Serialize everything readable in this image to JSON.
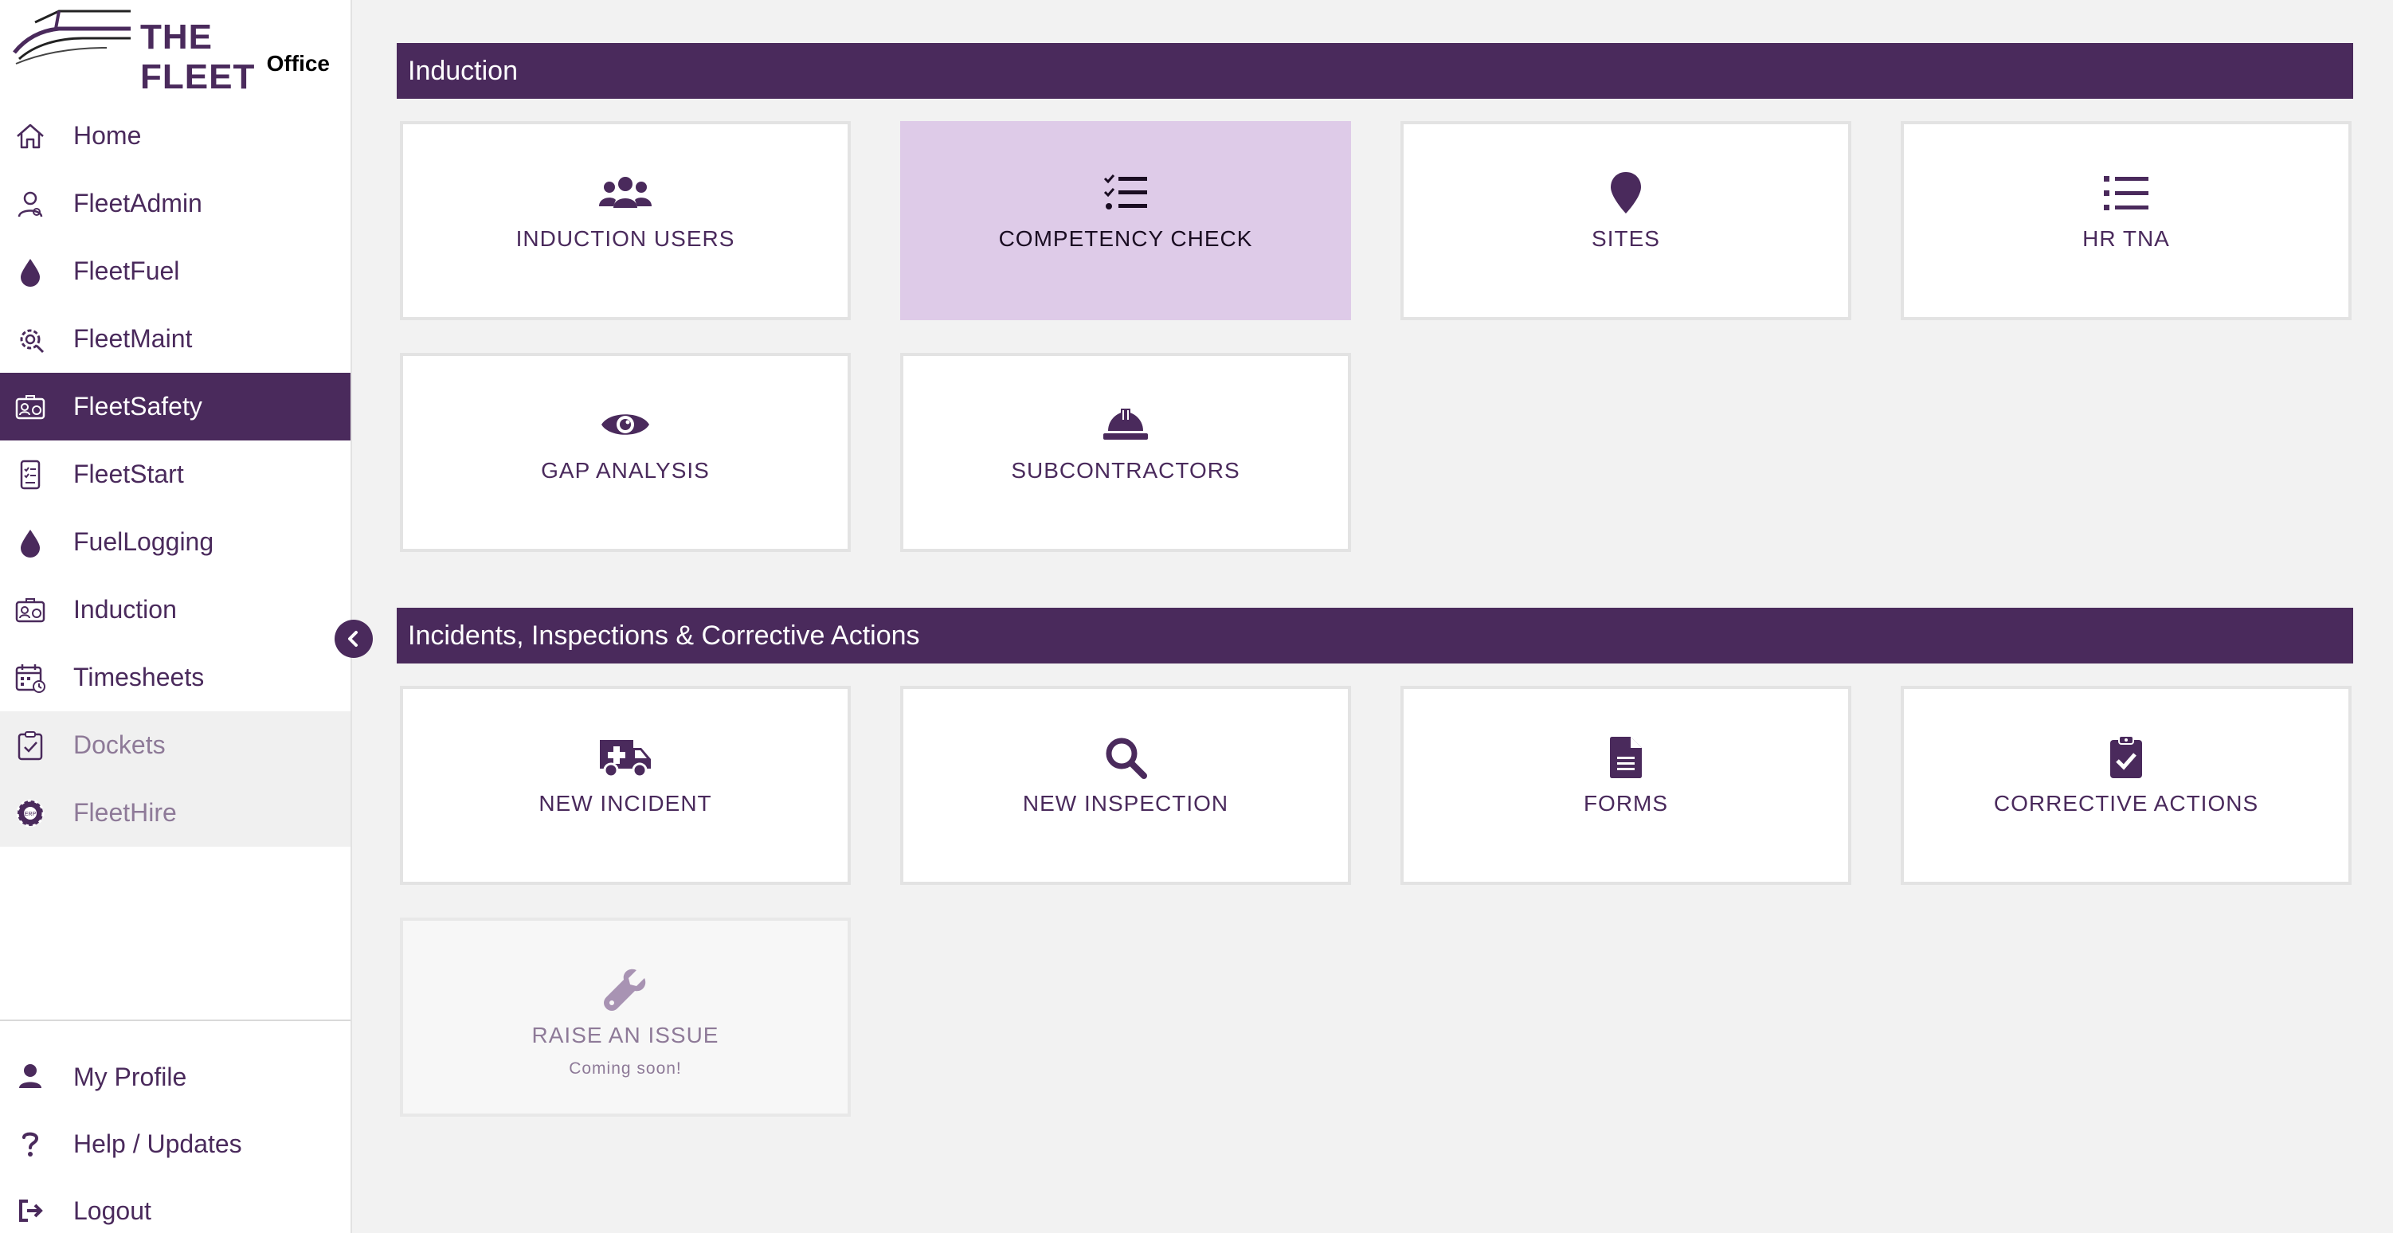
{
  "brand": {
    "name": "THE FLEET",
    "sub": "Office"
  },
  "sidebar": {
    "items": [
      {
        "label": "Home",
        "icon": "home-icon"
      },
      {
        "label": "FleetAdmin",
        "icon": "admin-user-icon"
      },
      {
        "label": "FleetFuel",
        "icon": "fuel-drop-icon"
      },
      {
        "label": "FleetMaint",
        "icon": "maintenance-gear-icon"
      },
      {
        "label": "FleetSafety",
        "icon": "id-card-icon",
        "active": true
      },
      {
        "label": "FleetStart",
        "icon": "mobile-checklist-icon"
      },
      {
        "label": "FuelLogging",
        "icon": "fuel-drop-icon"
      },
      {
        "label": "Induction",
        "icon": "id-card-icon"
      },
      {
        "label": "Timesheets",
        "icon": "calendar-clock-icon"
      },
      {
        "label": "Dockets",
        "icon": "clipboard-check-icon",
        "disabled": true
      },
      {
        "label": "FleetHire",
        "icon": "erp-gear-icon",
        "disabled": true
      }
    ],
    "bottom": [
      {
        "label": "My Profile",
        "icon": "user-icon"
      },
      {
        "label": "Help / Updates",
        "icon": "question-icon"
      },
      {
        "label": "Logout",
        "icon": "sign-out-icon"
      }
    ]
  },
  "sections": [
    {
      "title": "Induction",
      "tiles": [
        {
          "label": "INDUCTION USERS",
          "icon": "users-icon"
        },
        {
          "label": "COMPETENCY CHECK",
          "icon": "checklist-icon",
          "highlighted": true
        },
        {
          "label": "SITES",
          "icon": "map-marker-icon"
        },
        {
          "label": "HR TNA",
          "icon": "list-icon"
        },
        {
          "label": "GAP ANALYSIS",
          "icon": "eye-icon"
        },
        {
          "label": "SUBCONTRACTORS",
          "icon": "hard-hat-icon"
        }
      ]
    },
    {
      "title": "Incidents, Inspections & Corrective Actions",
      "tiles": [
        {
          "label": "NEW INCIDENT",
          "icon": "ambulance-icon"
        },
        {
          "label": "NEW INSPECTION",
          "icon": "search-icon"
        },
        {
          "label": "FORMS",
          "icon": "document-icon"
        },
        {
          "label": "CORRECTIVE ACTIONS",
          "icon": "clipboard-check-icon"
        },
        {
          "label": "RAISE AN ISSUE",
          "icon": "wrench-icon",
          "sublabel": "Coming soon!",
          "disabled": true
        }
      ]
    }
  ],
  "colors": {
    "primary": "#4a2a5c",
    "highlight": "#decbe8",
    "background": "#f2f2f2"
  }
}
